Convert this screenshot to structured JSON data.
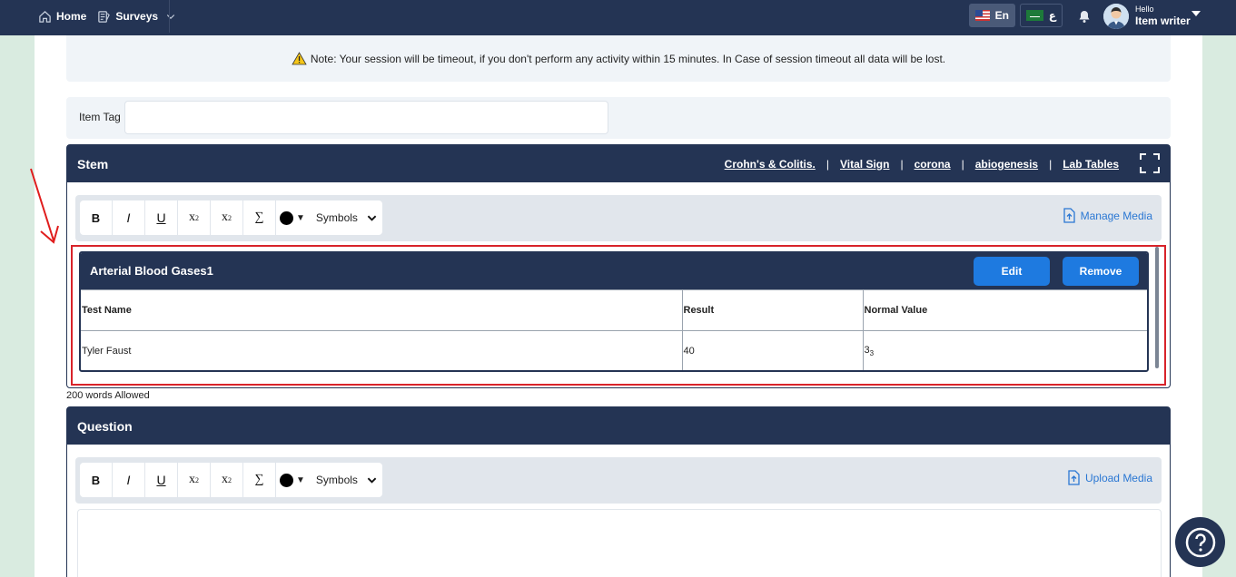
{
  "nav": {
    "home": "Home",
    "surveys": "Surveys",
    "lang_en": "En",
    "lang_ar": "ع",
    "user_hello": "Hello",
    "user_name": "Item writer"
  },
  "note": {
    "text": "Note: Your session will be timeout, if you don't perform any activity within 15 minutes. In Case of session timeout all data will be lost."
  },
  "item_tag": {
    "label": "Item Tag",
    "value": ""
  },
  "stem": {
    "title": "Stem",
    "links": [
      "Crohn's & Colitis.",
      "Vital Sign",
      "corona",
      "abiogenesis",
      "Lab Tables"
    ],
    "separator": "|",
    "media_label": "Manage Media",
    "words_allowed": "200 words Allowed"
  },
  "toolbar": {
    "bold": "B",
    "italic": "I",
    "underline": "U",
    "subscript_base": "x",
    "subscript_mark": "2",
    "superscript_base": "x",
    "superscript_mark": "2",
    "sigma": "∑",
    "symbols": "Symbols"
  },
  "lab_table": {
    "title": "Arterial Blood Gases1",
    "edit_label": "Edit",
    "remove_label": "Remove",
    "headers": [
      "Test Name",
      "Result",
      "Normal Value"
    ],
    "rows": [
      {
        "test_name": "Tyler Faust",
        "result": "40",
        "normal_value": "3",
        "normal_value_sub": "3"
      }
    ]
  },
  "question": {
    "title": "Question",
    "media_label": "Upload Media"
  },
  "colors": {
    "navy": "#243454",
    "accent_blue": "#1e7ae0",
    "highlight_red": "#d8232a",
    "page_bg": "#d9ebe0"
  }
}
